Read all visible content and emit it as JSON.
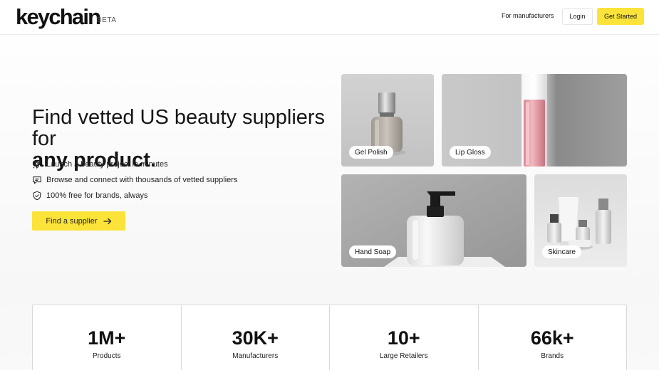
{
  "header": {
    "logo": "keychain",
    "badge": "BETA",
    "nav_link": "For manufacturers",
    "login_label": "Login",
    "cta_label": "Get Started",
    "cta_color": "#fbe33a"
  },
  "hero": {
    "headline_regular": "Find vetted US beauty suppliers for",
    "headline_bold": "any product.",
    "features": [
      {
        "icon": "rocket-icon",
        "text": "Launch a beauty project in minutes"
      },
      {
        "icon": "chat-bubble-icon",
        "text": "Browse and connect with thousands of vetted suppliers"
      },
      {
        "icon": "shield-check-icon",
        "text": "100% free for brands, always"
      }
    ],
    "button_label": "Find a supplier",
    "button_icon": "arrow-right-icon"
  },
  "categories": [
    {
      "label": "Gel Polish"
    },
    {
      "label": "Lip Gloss"
    },
    {
      "label": "Hand Soap"
    },
    {
      "label": "Skincare"
    }
  ],
  "stats": [
    {
      "value": "1M+",
      "label": "Products"
    },
    {
      "value": "30K+",
      "label": "Manufacturers"
    },
    {
      "value": "10+",
      "label": "Large Retailers"
    },
    {
      "value": "66k+",
      "label": "Brands"
    }
  ]
}
